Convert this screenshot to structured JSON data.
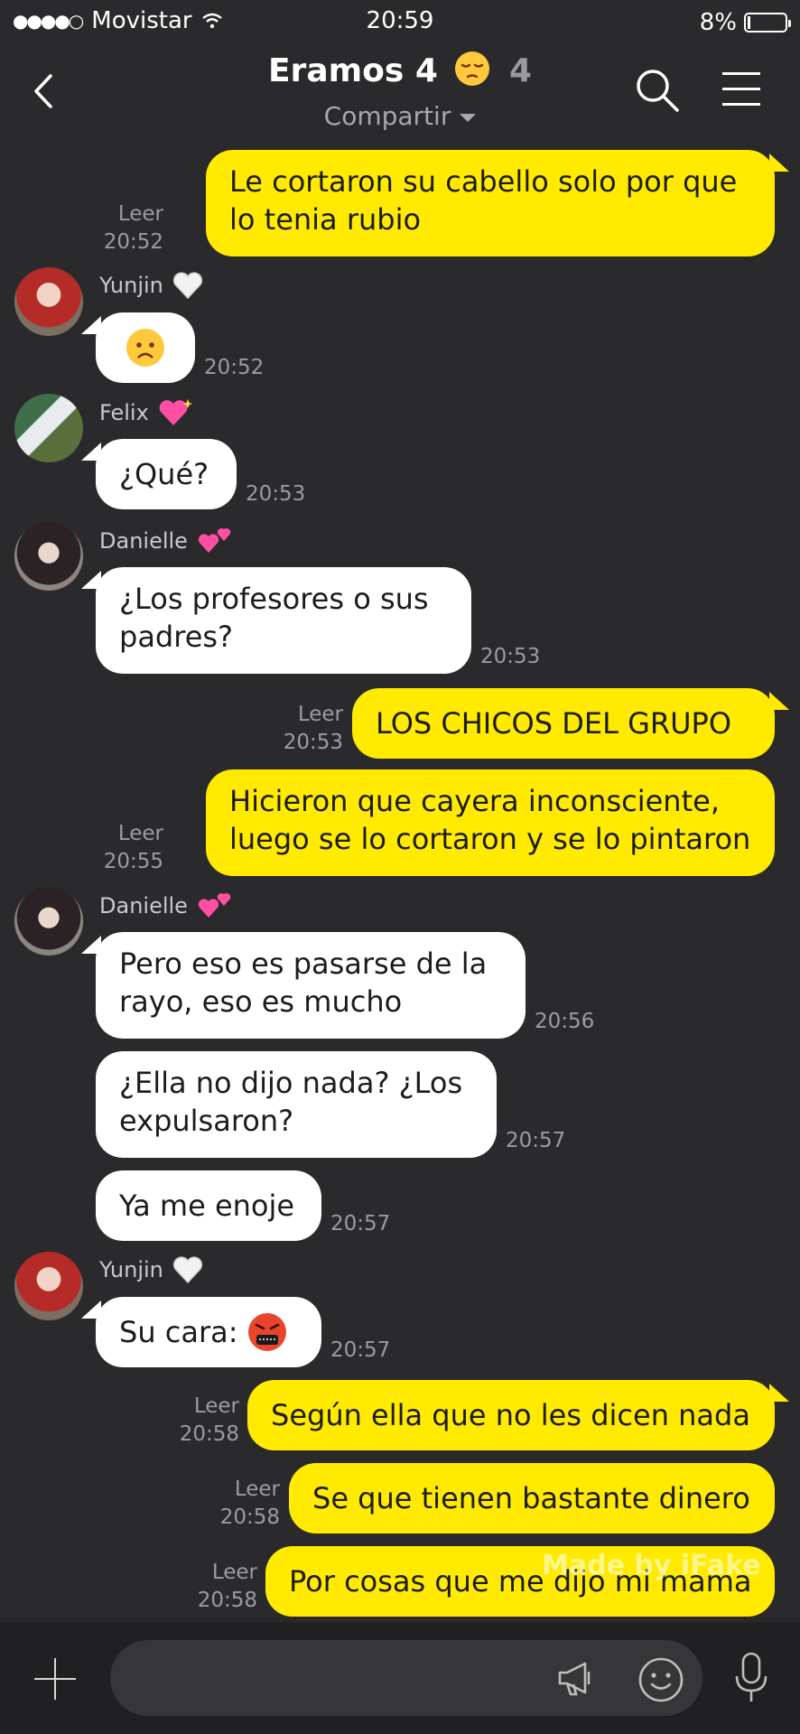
{
  "status": {
    "carrier": "Movistar",
    "time": "20:59",
    "battery": "8%",
    "battery_level": 0.08
  },
  "header": {
    "title": "Eramos 4",
    "member_count": "4",
    "subtitle": "Compartir"
  },
  "messages": [
    {
      "id": "m1",
      "lines": [
        "Le cortaron su cabello solo por que",
        "lo tenia rubio"
      ],
      "read": "Leer",
      "time": "20:52"
    },
    {
      "id": "m2",
      "sender": "Yunjin",
      "sender_emoji": "white-heart",
      "emoji": "worried-face",
      "time": "20:52"
    },
    {
      "id": "m3",
      "sender": "Felix",
      "sender_emoji": "sparkling-heart",
      "text": "¿Qué?",
      "time": "20:53"
    },
    {
      "id": "m4",
      "sender": "Danielle",
      "sender_emoji": "two-hearts",
      "lines": [
        "¿Los profesores o sus",
        "padres?"
      ],
      "time": "20:53"
    },
    {
      "id": "m5",
      "text": "LOS CHICOS DEL GRUPO",
      "read": "Leer",
      "time": "20:53"
    },
    {
      "id": "m6",
      "lines": [
        "Hicieron que cayera inconsciente,",
        "luego se lo cortaron y se lo pintaron"
      ],
      "read": "Leer",
      "time": "20:55"
    },
    {
      "id": "m7",
      "sender": "Danielle",
      "sender_emoji": "two-hearts",
      "lines": [
        "Pero eso es pasarse de la",
        "rayo, eso es mucho"
      ],
      "time": "20:56"
    },
    {
      "id": "m8",
      "lines": [
        "¿Ella no dijo nada? ¿Los",
        "expulsaron?"
      ],
      "time": "20:57"
    },
    {
      "id": "m9",
      "text": "Ya me enoje",
      "time": "20:57"
    },
    {
      "id": "m10",
      "sender": "Yunjin",
      "sender_emoji": "white-heart",
      "text": "Su cara:",
      "emoji": "cursing-face",
      "time": "20:57"
    },
    {
      "id": "m11",
      "text": "Según ella que no les dicen nada",
      "read": "Leer",
      "time": "20:58"
    },
    {
      "id": "m12",
      "text": "Se que tienen bastante dinero",
      "read": "Leer",
      "time": "20:58"
    },
    {
      "id": "m13",
      "text": "Por cosas que me dijo mi mama",
      "read": "Leer",
      "time": "20:58"
    }
  ],
  "watermark": "Made by iFake",
  "colors": {
    "background": "#2a2a2d",
    "outgoing_bubble": "#ffea00",
    "incoming_bubble": "#ffffff"
  },
  "input_icons": [
    "plus-icon",
    "megaphone-icon",
    "smiley-icon",
    "microphone-icon"
  ]
}
